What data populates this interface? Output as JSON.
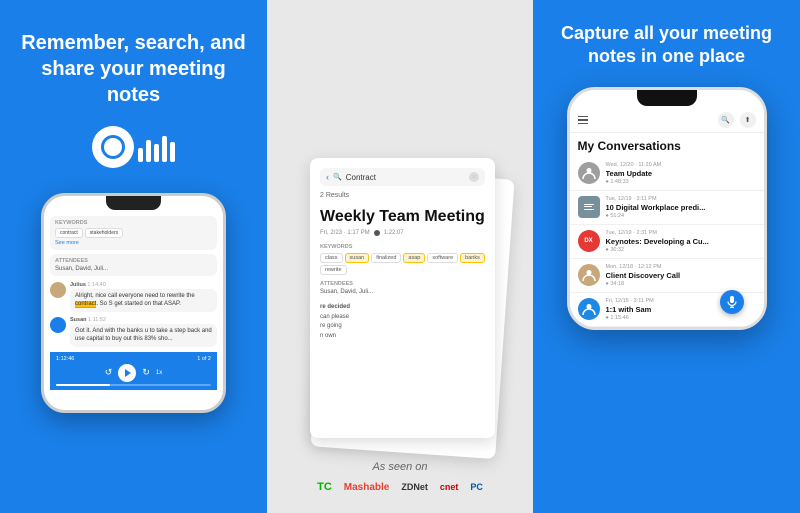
{
  "panels": {
    "left": {
      "heading": "Remember, search, and share your meeting notes",
      "logo_alt": "Otter.ai logo",
      "phone": {
        "keywords_label": "KEYWORDS",
        "keywords": [
          "contract",
          "stakeholders"
        ],
        "see_more": "See more",
        "attendees_label": "ATTENDEES",
        "attendees_value": "Susan, David, Juli...",
        "messages": [
          {
            "speaker": "Julius",
            "time": "1:14:40",
            "text": "Alright, nice call everyone, need to rewrite the contract. So S get started on that ASAP.",
            "highlight": "contract"
          },
          {
            "speaker": "Susan",
            "time": "1:11:52",
            "text": "Got it. And with the banks u to take a step back and use capital to buy out this 83% sho..."
          }
        ],
        "player": {
          "time": "1:12:46",
          "pagination": "1 of 2",
          "speed": "1x"
        }
      }
    },
    "middle": {
      "search_placeholder": "Contract",
      "results_count": "2 Results",
      "meeting_title": "Weekly Team Meeting",
      "meeting_date": "Fri, 2/23 · 1:17 PM",
      "meeting_duration": "1:22:07",
      "section_keywords_label": "KEYWORDS",
      "keywords": [
        "class",
        "susan",
        "finalized",
        "asap",
        "software",
        "banks",
        "rewrite"
      ],
      "attendees_label": "ATTENDEES",
      "attendees_value": "Susan, David, Juli...",
      "as_seen_on": "As seen on",
      "media": [
        "TechCrunch",
        "Mashable",
        "ZDNet",
        "CNET",
        "PC Mag"
      ]
    },
    "right": {
      "heading": "Capture all your meeting notes in one place",
      "conversations_title": "My Conversations",
      "conversations": [
        {
          "date": "Wed, 12/20 · 11:20 AM",
          "name": "Team Update",
          "duration": "1:48:33",
          "avatar_type": "person",
          "avatar_color": "#9e9e9e"
        },
        {
          "date": "Tue, 12/19 · 3:11 PM",
          "name": "10 Digital Workplace predi...",
          "duration": "51:24",
          "avatar_type": "doc",
          "avatar_color": "#78909c"
        },
        {
          "date": "Tue, 12/19 · 2:31 PM",
          "name": "Keynotes: Developing a Cu...",
          "duration": "30:32",
          "avatar_type": "initials",
          "avatar_color": "#e53935",
          "initials": "DX"
        },
        {
          "date": "Mon, 12/18 · 12:12 PM",
          "name": "Client Discovery Call",
          "duration": "34:18",
          "avatar_type": "person",
          "avatar_color": "#c8a87a"
        },
        {
          "date": "Fri, 12/15 · 3:11 PM",
          "name": "1:1 with Sam",
          "duration": "1:15:46",
          "avatar_type": "person",
          "avatar_color": "#1e88e5"
        }
      ],
      "mic_button_label": "Record"
    }
  }
}
